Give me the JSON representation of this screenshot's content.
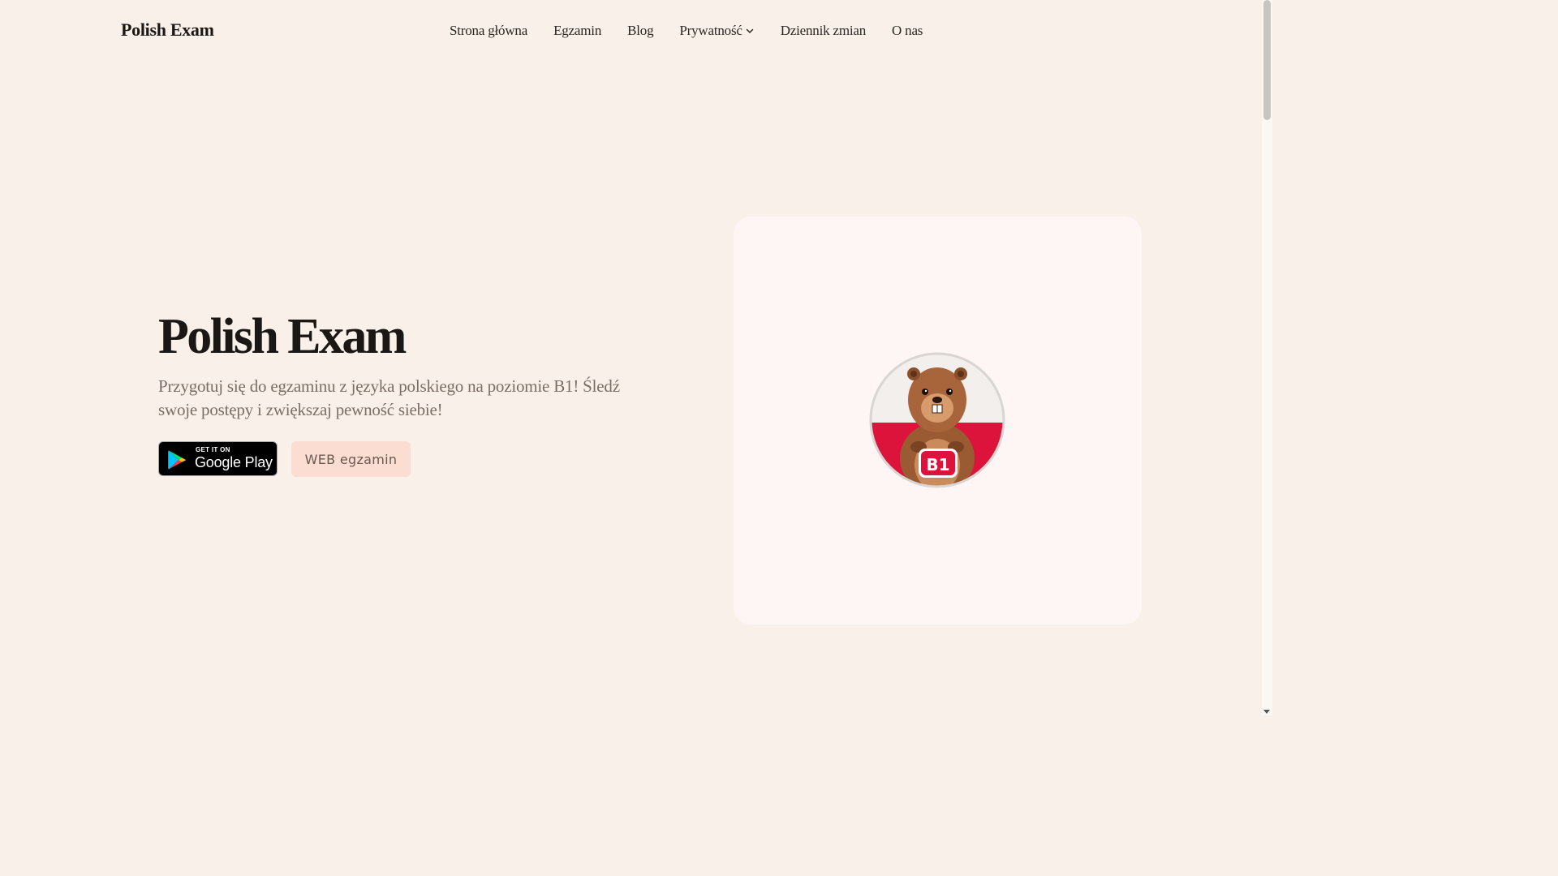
{
  "header": {
    "brand": "Polish Exam",
    "nav": [
      {
        "label": "Strona główna"
      },
      {
        "label": "Egzamin"
      },
      {
        "label": "Blog"
      },
      {
        "label": "Prywatność",
        "has_dropdown": true
      },
      {
        "label": "Dziennik zmian"
      },
      {
        "label": "O nas"
      }
    ]
  },
  "hero": {
    "title": "Polish Exam",
    "subtitle": "Przygotuj się do egzaminu z języka polskiego na poziomie B1! Śledź swoje postępy i zwiększaj pewność siebie!",
    "google_play": {
      "small_text": "GET IT ON",
      "big_text": "Google Play"
    },
    "web_button": "WEB egzamin",
    "badge_text": "B1"
  },
  "colors": {
    "background": "#f9f1e9",
    "card": "#fef6f4",
    "web_button_bg": "#fbddd1",
    "flag_red": "#dc143c",
    "flag_white": "#ffffff"
  }
}
